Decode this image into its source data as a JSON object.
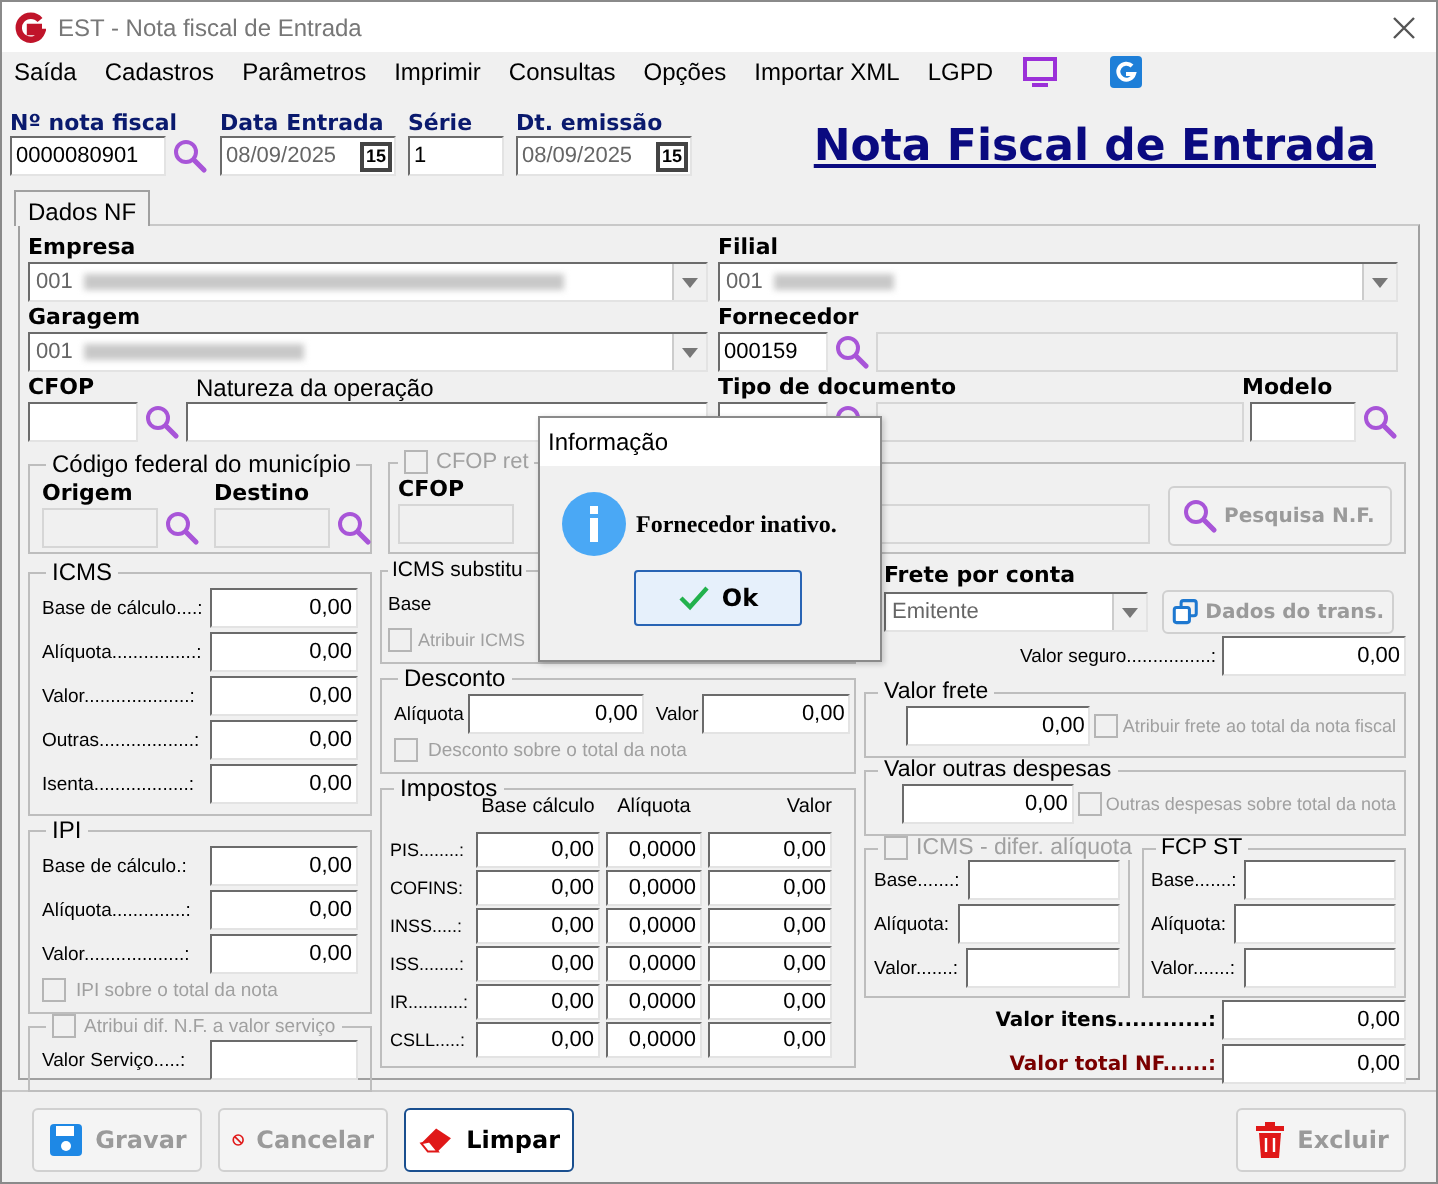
{
  "window": {
    "title": "EST - Nota fiscal de Entrada"
  },
  "menu": [
    "Saída",
    "Cadastros",
    "Parâmetros",
    "Imprimir",
    "Consultas",
    "Opções",
    "Importar XML",
    "LGPD"
  ],
  "header": {
    "fields": [
      {
        "label": "Nº nota fiscal",
        "value": "0000080901",
        "kind": "search"
      },
      {
        "label": "Data Entrada",
        "value": "08/09/2025",
        "kind": "date",
        "button": "15"
      },
      {
        "label": "Série",
        "value": "1",
        "kind": "plain"
      },
      {
        "label": "Dt. emissão",
        "value": "08/09/2025",
        "kind": "date",
        "button": "15"
      }
    ],
    "title": "Nota Fiscal de Entrada"
  },
  "tabs": [
    {
      "label": "Dados NF",
      "selected": true
    }
  ],
  "empresa": {
    "label": "Empresa",
    "value": "001"
  },
  "filial": {
    "label": "Filial",
    "value": "001"
  },
  "garagem": {
    "label": "Garagem",
    "value": "001"
  },
  "fornecedor": {
    "label": "Fornecedor",
    "code": "000159"
  },
  "cfop": {
    "label": "CFOP"
  },
  "natureza": {
    "label": "Natureza da operação"
  },
  "tipo_documento": {
    "label": "Tipo de documento"
  },
  "modelo": {
    "label": "Modelo"
  },
  "municipio": {
    "title": "Código federal do município",
    "origem": "Origem",
    "destino": "Destino"
  },
  "cfop_group": {
    "checkbox": {
      "label": "CFOP ret",
      "checked": false,
      "disabled": true
    },
    "cfop_label": "CFOP",
    "button": "Pesquisa N.F.",
    "button_disabled": true
  },
  "icms": {
    "title": "ICMS",
    "rows": [
      {
        "label": "Base de cálculo....:",
        "value": "0,00"
      },
      {
        "label": "Alíquota................:",
        "value": "0,00"
      },
      {
        "label": "Valor....................:",
        "value": "0,00"
      },
      {
        "label": "Outras..................:",
        "value": "0,00"
      },
      {
        "label": "Isenta..................:",
        "value": "0,00"
      }
    ]
  },
  "ipi": {
    "title": "IPI",
    "rows": [
      {
        "label": "Base de cálculo.:",
        "value": "0,00"
      },
      {
        "label": "Alíquota..............:",
        "value": "0,00"
      },
      {
        "label": "Valor...................:",
        "value": "0,00"
      }
    ],
    "checkbox": {
      "label": "IPI sobre o total da nota",
      "checked": false,
      "disabled": true
    }
  },
  "servico": {
    "checkbox": {
      "label": "Atribui dif. N.F. a valor serviço",
      "checked": false,
      "disabled": true
    },
    "label": "Valor Serviço.....:"
  },
  "icms_st": {
    "title": "ICMS substitu",
    "base_label": "Base",
    "checkbox": {
      "label": "Atribuir ICMS",
      "checked": false,
      "disabled": true
    }
  },
  "desconto": {
    "title": "Desconto",
    "aliquota_label": "Alíquota",
    "aliquota": "0,00",
    "valor_label": "Valor",
    "valor": "0,00",
    "checkbox": {
      "label": "Desconto sobre o total da nota",
      "checked": false,
      "disabled": true
    }
  },
  "impostos": {
    "title": "Impostos",
    "columns": [
      "Base cálculo",
      "Alíquota",
      "Valor"
    ],
    "rows": [
      {
        "label": "PIS........:",
        "values": [
          "0,00",
          "0,0000",
          "0,00"
        ]
      },
      {
        "label": "COFINS:",
        "values": [
          "0,00",
          "0,0000",
          "0,00"
        ]
      },
      {
        "label": "INSS.....:",
        "values": [
          "0,00",
          "0,0000",
          "0,00"
        ]
      },
      {
        "label": "ISS........:",
        "values": [
          "0,00",
          "0,0000",
          "0,00"
        ]
      },
      {
        "label": "IR...........:",
        "values": [
          "0,00",
          "0,0000",
          "0,00"
        ]
      },
      {
        "label": "CSLL.....:",
        "values": [
          "0,00",
          "0,0000",
          "0,00"
        ]
      }
    ]
  },
  "frete": {
    "label": "Frete por conta",
    "value": "Emitente",
    "button": "Dados do trans.",
    "button_disabled": true,
    "seguro_label": "Valor seguro................:",
    "seguro": "0,00"
  },
  "valor_frete": {
    "title": "Valor frete",
    "value": "0,00",
    "checkbox": {
      "label": "Atribuir frete ao total da nota fiscal",
      "checked": false,
      "disabled": true
    }
  },
  "outras": {
    "title": "Valor outras despesas",
    "value": "0,00",
    "checkbox": {
      "label": "Outras despesas sobre total da nota",
      "checked": false,
      "disabled": true
    }
  },
  "difal": {
    "checkbox": {
      "label": "ICMS - difer. alíquota",
      "checked": false,
      "disabled": true
    },
    "rows": [
      "Base.......:",
      "Alíquota:",
      "Valor.......:"
    ]
  },
  "fcp": {
    "title": "FCP ST",
    "rows": [
      "Base.......:",
      "Alíquota:",
      "Valor.......:"
    ]
  },
  "totals": [
    {
      "label": "Valor itens............:",
      "value": "0,00",
      "kind": "items"
    },
    {
      "label": "Valor total NF......:",
      "value": "0,00",
      "kind": "total"
    }
  ],
  "buttons": [
    {
      "label": "Gravar",
      "disabled": true,
      "kind": "save"
    },
    {
      "label": "Cancelar",
      "disabled": true,
      "kind": "cancel"
    },
    {
      "label": "Limpar",
      "disabled": false,
      "kind": "clear"
    },
    {
      "label": "Excluir",
      "disabled": true,
      "kind": "delete"
    }
  ],
  "dialog": {
    "title": "Informação",
    "message": "Fornecedor inativo.",
    "button": "Ok"
  }
}
